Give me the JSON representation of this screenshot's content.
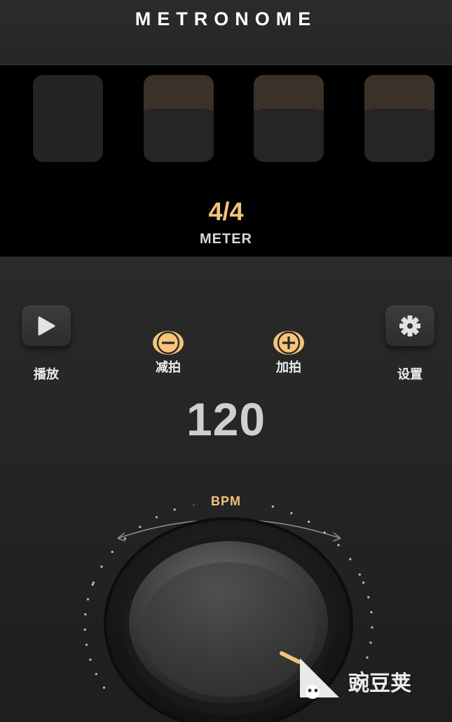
{
  "header": {
    "title": "METRONOME"
  },
  "beats": {
    "count": 4,
    "active_index": 0
  },
  "meter": {
    "value": "4/4",
    "label": "METER"
  },
  "controls": {
    "play_label": "播放",
    "decrease_label": "减拍",
    "increase_label": "加拍",
    "settings_label": "设置"
  },
  "tempo": {
    "bpm": "120",
    "unit_label": "BPM"
  },
  "watermark": {
    "text": "豌豆荚"
  },
  "colors": {
    "accent": "#f3c27a",
    "background": "#272727",
    "panel": "#000000"
  }
}
